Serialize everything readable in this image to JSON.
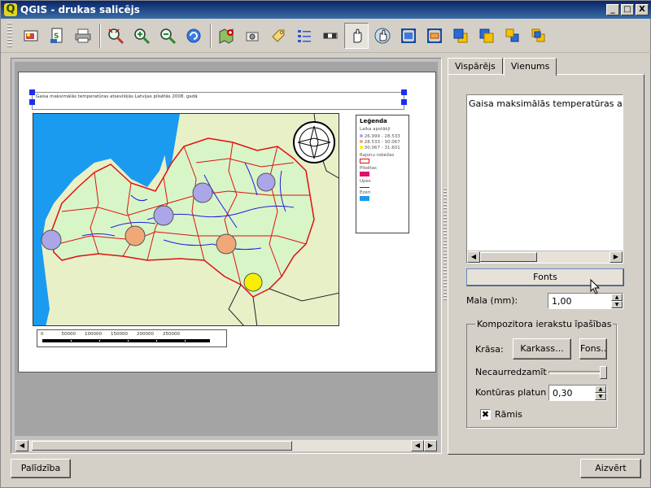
{
  "window": {
    "title": "QGIS - drukas salicējs",
    "logo_letter": "Q",
    "min_label": "_",
    "max_label": "□",
    "close_label": "X"
  },
  "toolbar": {
    "icons": [
      "add-image-icon",
      "export-svg-icon",
      "print-icon",
      "zoom-full-icon",
      "zoom-in-icon",
      "zoom-out-icon",
      "refresh-icon",
      "add-map-icon",
      "add-photo-icon",
      "add-label-icon",
      "add-legend-icon",
      "add-scalebar-icon",
      "select-move-icon",
      "move-content-icon",
      "group-icon",
      "ungroup-icon",
      "raise-icon",
      "lower-icon",
      "move-top-icon",
      "move-bottom-icon"
    ]
  },
  "composition": {
    "label_text": "Gaisa maksimālās temperatūras atsevišķās Latvijas pilsētās 2008. gadā",
    "legend": {
      "title": "Leģenda",
      "group_label": "Laika apstākļi",
      "ranges": [
        "26.999 - 28.533",
        "28.533 - 30.067",
        "30.067 - 31.601"
      ],
      "items": [
        "Rajonu robežas",
        "Pilsētas",
        "Upes",
        "Ezeri"
      ]
    },
    "scalebar_labels": [
      "0",
      "50000",
      "100000",
      "150000",
      "200000",
      "250000"
    ],
    "colors": {
      "land": "#e8f0c8",
      "water": "#1a9bf0",
      "district_fill": "#d8f5c8",
      "border_red": "#e01010",
      "river_blue": "#2020e0",
      "city_cool": "#aaa6e8",
      "city_mid": "#f0a878",
      "city_hot": "#f8f000"
    }
  },
  "panel": {
    "tabs": [
      "Vispārējs",
      "Vienums"
    ],
    "active_tab": "Vienums",
    "label_text_value": "Gaisa maksimālās temperatūras atsevišķ",
    "fonts_button": "Fonts",
    "margin_label": "Mala (mm):",
    "margin_value": "1,00",
    "group_title": "Kompozitora ierakstu īpašības",
    "color_label": "Krāsa:",
    "frame_button": "Karkass...",
    "background_button": "Fons...",
    "opacity_label": "Necaurredzamīt",
    "opacity_value": 1.0,
    "outline_label": "Kontūras platun",
    "outline_value": "0,30",
    "frame_checkbox_label": "Rāmis",
    "frame_checked": "✖"
  },
  "bottom": {
    "help": "Palīdzība",
    "close": "Aizvērt"
  }
}
